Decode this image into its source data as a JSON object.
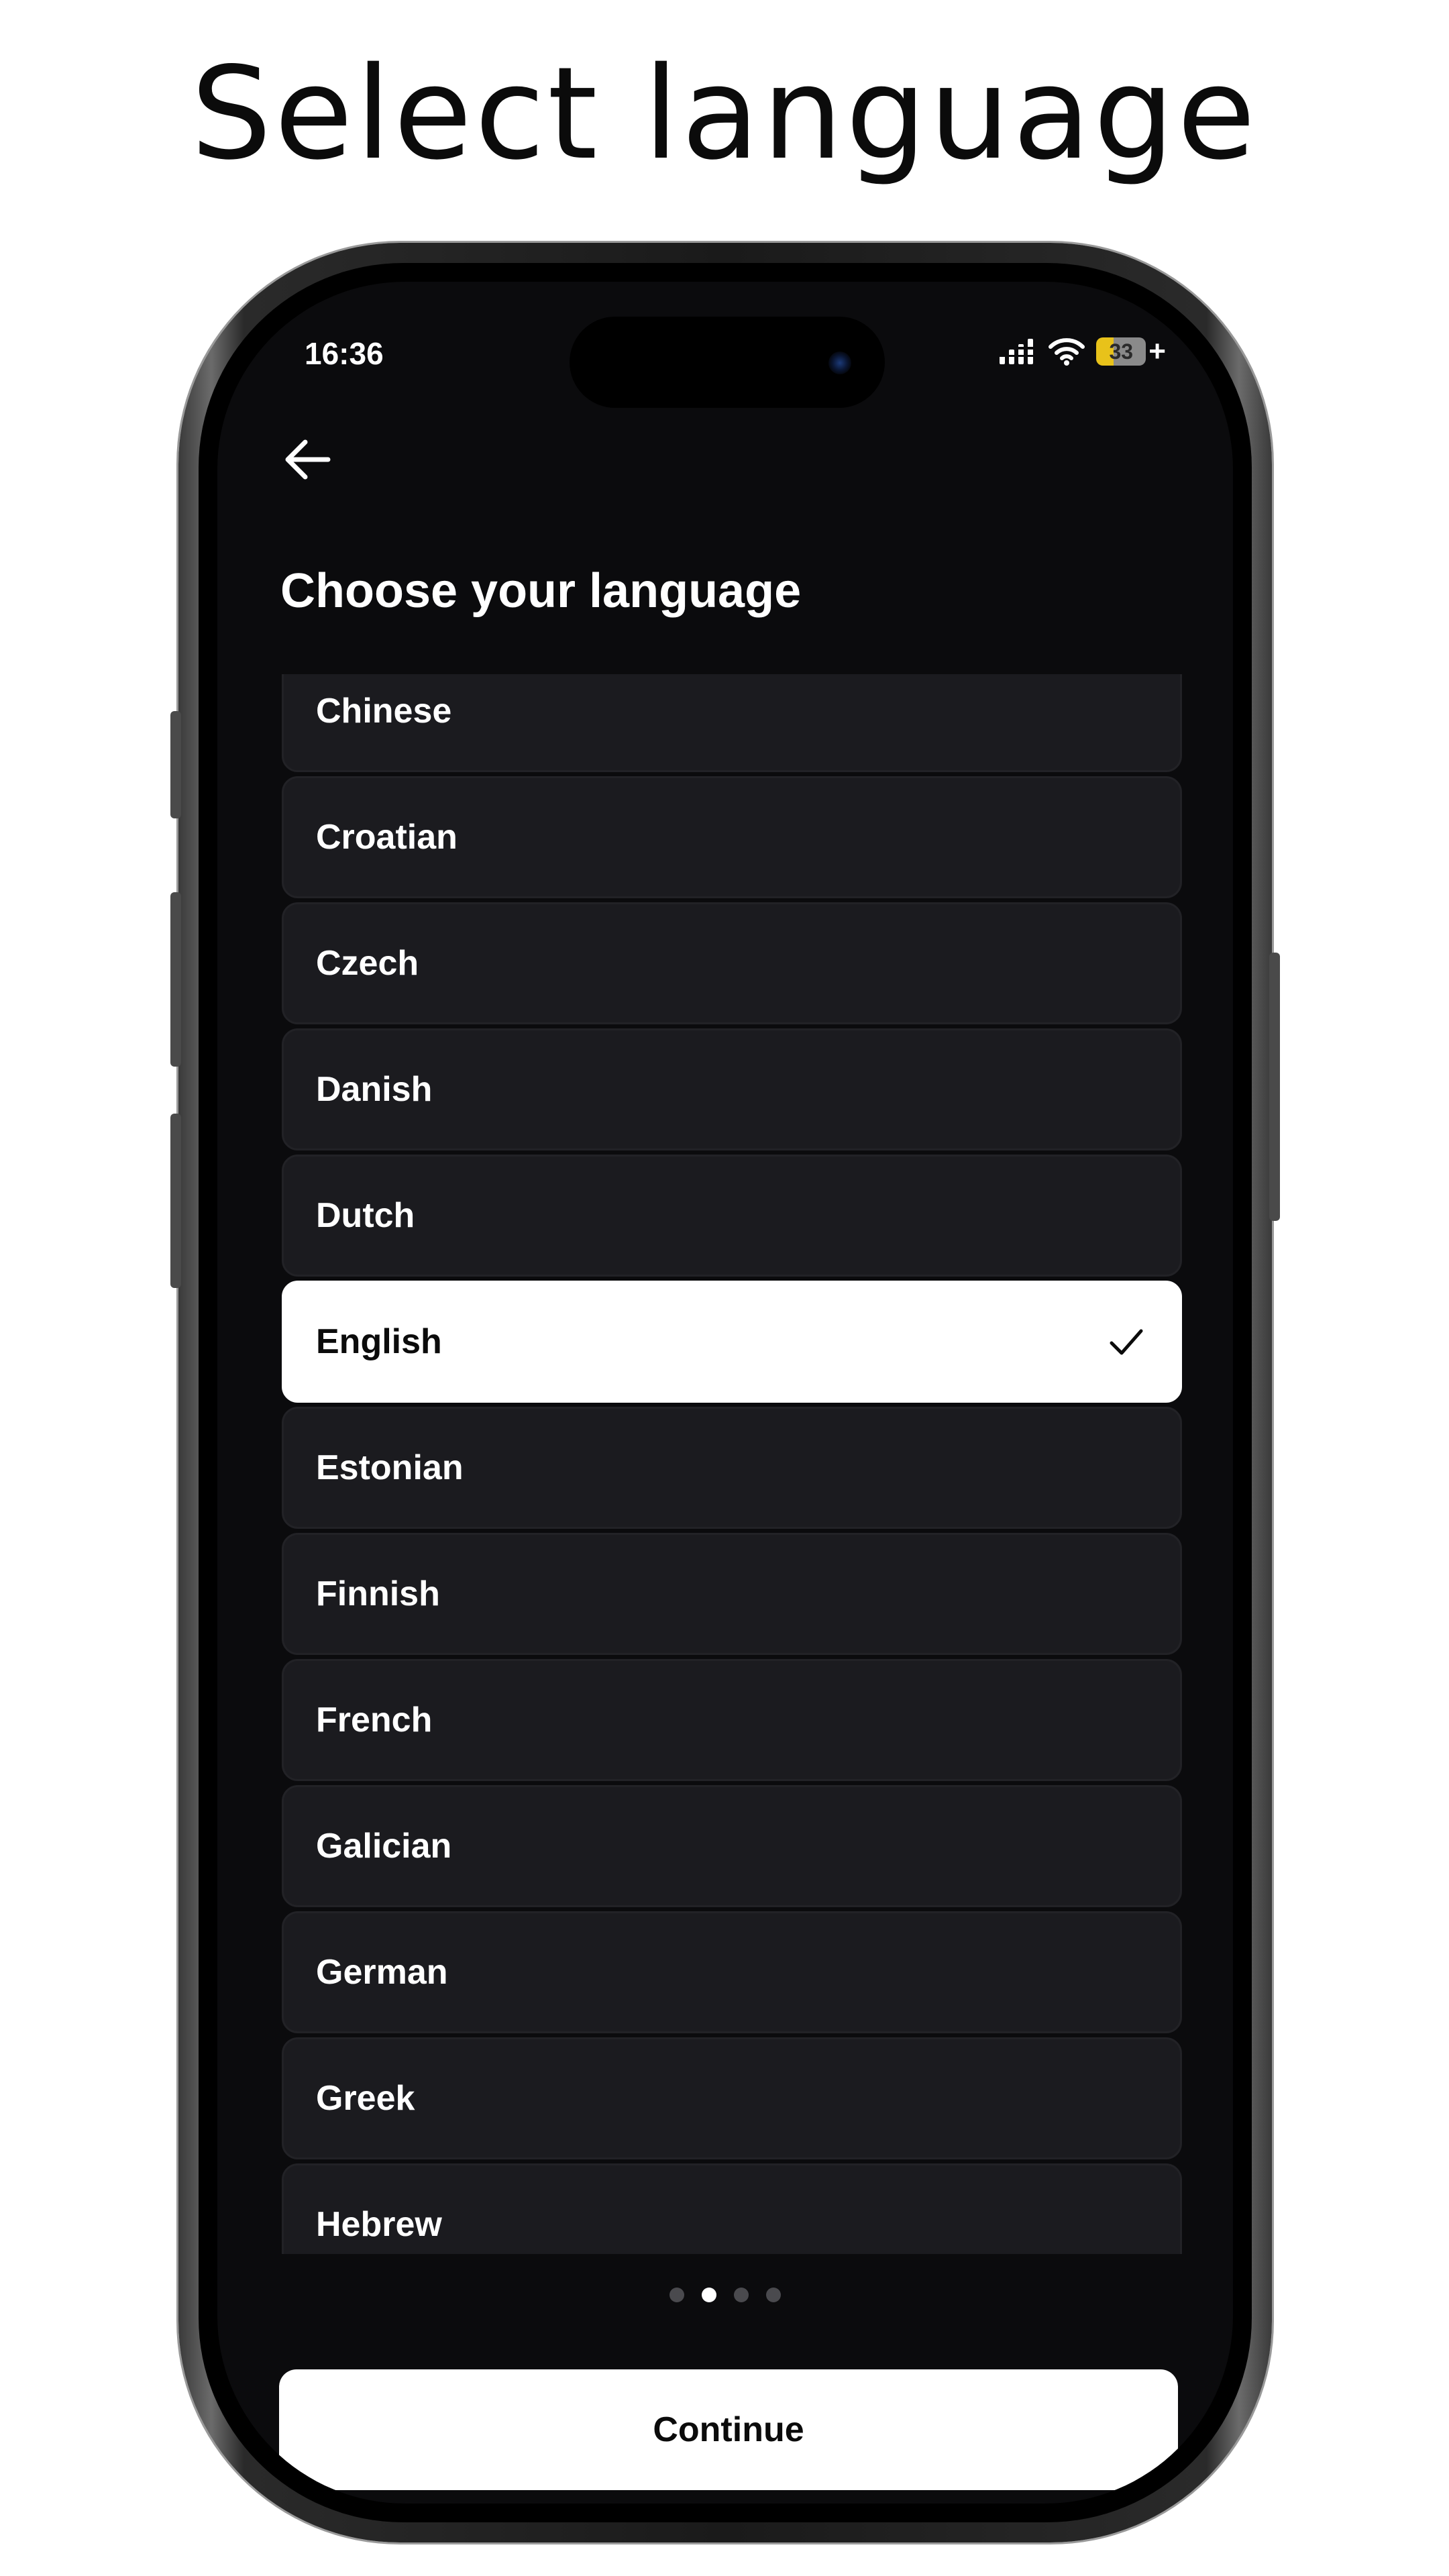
{
  "headline": "Select language",
  "status_bar": {
    "time": "16:36",
    "battery_level": "33",
    "battery_plus": "+"
  },
  "header": {
    "back_icon": "arrow-left-icon",
    "title": "Choose your language"
  },
  "languages": [
    {
      "label": "Chinese",
      "selected": false
    },
    {
      "label": "Croatian",
      "selected": false
    },
    {
      "label": "Czech",
      "selected": false
    },
    {
      "label": "Danish",
      "selected": false
    },
    {
      "label": "Dutch",
      "selected": false
    },
    {
      "label": "English",
      "selected": true
    },
    {
      "label": "Estonian",
      "selected": false
    },
    {
      "label": "Finnish",
      "selected": false
    },
    {
      "label": "French",
      "selected": false
    },
    {
      "label": "Galician",
      "selected": false
    },
    {
      "label": "German",
      "selected": false
    },
    {
      "label": "Greek",
      "selected": false
    },
    {
      "label": "Hebrew",
      "selected": false
    }
  ],
  "pagination": {
    "total": 4,
    "current": 2
  },
  "continue_label": "Continue",
  "colors": {
    "screen_background": "#0b0b0d",
    "item_background": "#1b1b1f",
    "selected_background": "#ffffff",
    "battery_accent": "#e8c21a"
  }
}
